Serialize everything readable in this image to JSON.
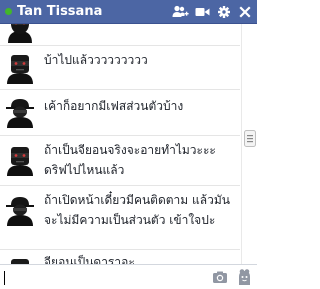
{
  "header": {
    "title": "Tan Tissana",
    "status": "online",
    "icons": [
      "add-friend-icon",
      "video-call-icon",
      "gear-icon",
      "close-icon"
    ]
  },
  "messages": [
    {
      "avatar": "masked-face-avatar",
      "text": ""
    },
    {
      "avatar": "masked-face-avatar",
      "text": "บ้าไปแล้ววววววววว"
    },
    {
      "avatar": "masked-face-avatar",
      "text": "เค้าก็อยากมีเฟสส่วนตัวบ้าง"
    },
    {
      "avatar": "masked-face-avatar",
      "text": "ถ้าเป็นจียอนจริงจะอายทำไมวะะะ ดริฟไปไหนแล้ว"
    },
    {
      "avatar": "masked-face-avatar",
      "text": "ถ้าเปิดหน้าเดี๋ยวมีคนติดตาม แล้วมันจะไม่มีความเป็นส่วนตัว เข้าใจปะ"
    },
    {
      "avatar": "masked-face-avatar",
      "text": "จียอนเป็นดาราอะ"
    }
  ],
  "composer": {
    "value": "",
    "icons": [
      "camera-icon",
      "sticker-icon"
    ]
  },
  "colors": {
    "header_bg": "#4c66a4",
    "online_dot": "#42b72a",
    "text": "#1d2129"
  }
}
